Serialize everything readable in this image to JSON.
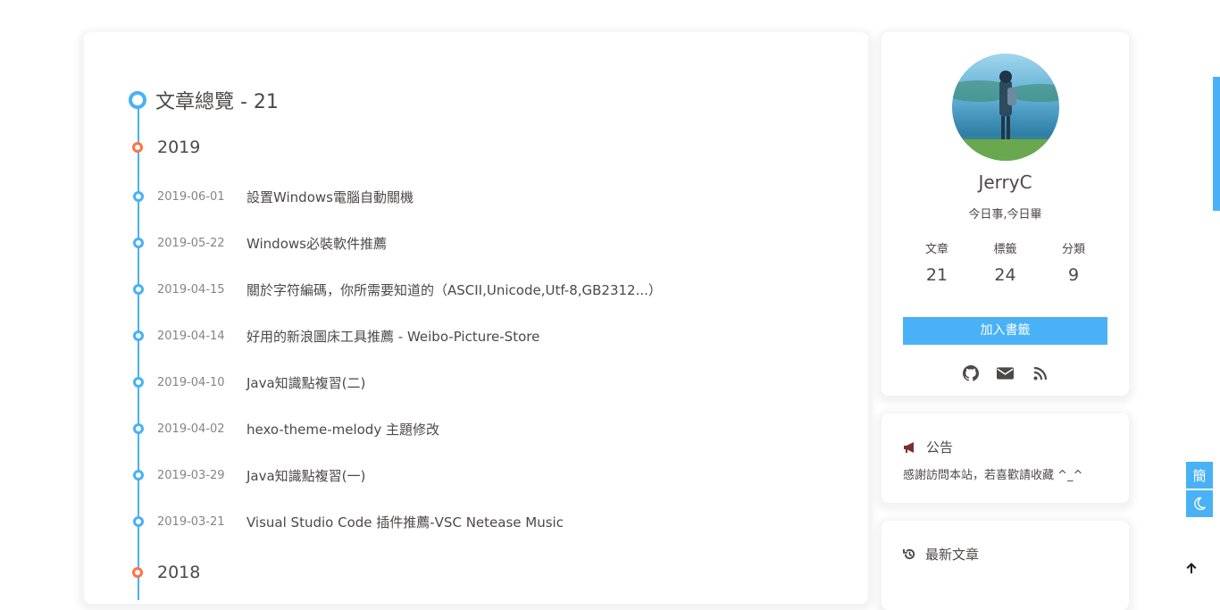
{
  "archive": {
    "title": "文章總覽 - 21",
    "years": [
      {
        "year": "2019"
      },
      {
        "year": "2018"
      }
    ],
    "posts": [
      {
        "date": "2019-06-01",
        "title": "設置Windows電腦自動關機"
      },
      {
        "date": "2019-05-22",
        "title": "Windows必裝軟件推薦"
      },
      {
        "date": "2019-04-15",
        "title": "關於字符編碼，你所需要知道的（ASCII,Unicode,Utf-8,GB2312...）"
      },
      {
        "date": "2019-04-14",
        "title": "好用的新浪圖床工具推薦 - Weibo-Picture-Store"
      },
      {
        "date": "2019-04-10",
        "title": "Java知識點複習(二)"
      },
      {
        "date": "2019-04-02",
        "title": "hexo-theme-melody 主題修改"
      },
      {
        "date": "2019-03-29",
        "title": "Java知識點複習(一)"
      },
      {
        "date": "2019-03-21",
        "title": "Visual Studio Code 插件推薦-VSC Netease Music"
      }
    ]
  },
  "profile": {
    "author": "JerryC",
    "description": "今日事,今日畢",
    "stats": [
      {
        "label": "文章",
        "value": "21"
      },
      {
        "label": "標籤",
        "value": "24"
      },
      {
        "label": "分類",
        "value": "9"
      }
    ],
    "bookmark_label": "加入書籤",
    "social_icons": [
      "github-icon",
      "envelope-icon",
      "rss-icon"
    ]
  },
  "announcement": {
    "title": "公告",
    "text": "感謝訪問本站，若喜歡請收藏 ^_^"
  },
  "recent": {
    "title": "最新文章"
  },
  "rightside": {
    "translate_label": "簡"
  },
  "colors": {
    "accent": "#49b1f5",
    "year_dot": "#ff7242",
    "text": "#4c4948",
    "date": "#858585"
  }
}
